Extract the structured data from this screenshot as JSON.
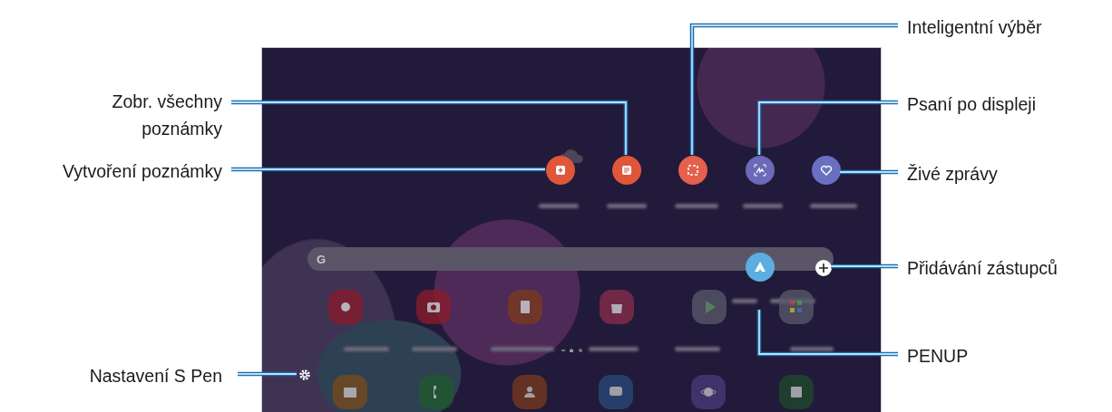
{
  "search_bar": {
    "logo": "G"
  },
  "callouts": [
    {
      "label": "Zobr. všechny\npoznámky"
    },
    {
      "label": "Vytvoření poznámky"
    },
    {
      "label": "Nastavení S Pen"
    },
    {
      "label": "Inteligentní výběr"
    },
    {
      "label": "Psaní po displeji"
    },
    {
      "label": "Živé zprávy"
    },
    {
      "label": "Přidávání zástupců"
    },
    {
      "label": "PENUP"
    }
  ]
}
